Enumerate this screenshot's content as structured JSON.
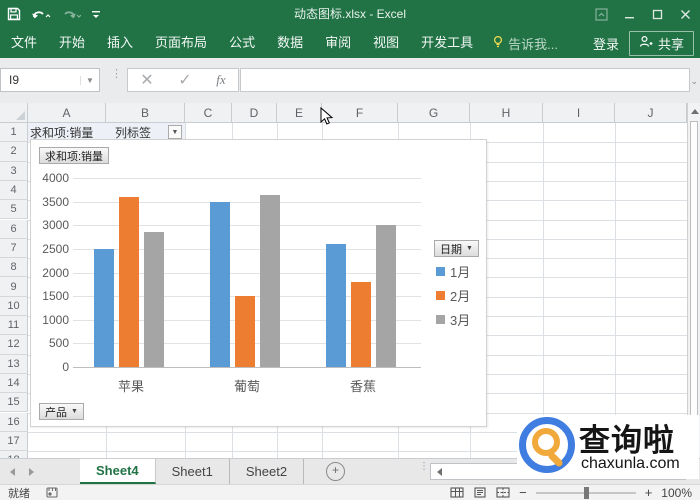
{
  "title_bar": {
    "title": "动态图标.xlsx - Excel"
  },
  "ribbon": {
    "tabs": [
      "文件",
      "开始",
      "插入",
      "页面布局",
      "公式",
      "数据",
      "审阅",
      "视图",
      "开发工具"
    ],
    "tell_me": "告诉我...",
    "sign_in": "登录",
    "share": "共享"
  },
  "formula_bar": {
    "name_box": "I9",
    "cancel_label": "✕",
    "enter_label": "✓",
    "fx_label": "fx",
    "value": ""
  },
  "grid": {
    "columns": [
      "A",
      "B",
      "C",
      "D",
      "E",
      "F",
      "G",
      "H",
      "I",
      "J"
    ],
    "row_count": 18,
    "cells": {
      "A1": "求和项:销量",
      "B1": "列标签"
    }
  },
  "chart_data": {
    "type": "bar",
    "title": "",
    "categories": [
      "苹果",
      "葡萄",
      "香蕉"
    ],
    "series": [
      {
        "name": "1月",
        "color": "#5B9BD5",
        "values": [
          2500,
          3500,
          2600
        ]
      },
      {
        "name": "2月",
        "color": "#ED7D31",
        "values": [
          3600,
          1500,
          1800
        ]
      },
      {
        "name": "3月",
        "color": "#A5A5A5",
        "values": [
          2850,
          3650,
          3000
        ]
      }
    ],
    "ylim": [
      0,
      4000
    ],
    "ytick_step": 500,
    "grid": true,
    "legend_position": "right",
    "legend_title": "日期",
    "value_field_button": "求和项:销量",
    "legend_field_button": "日期",
    "axis_field_button": "产品"
  },
  "sheet_tabs": {
    "tabs": [
      "Sheet4",
      "Sheet1",
      "Sheet2"
    ],
    "active": "Sheet4",
    "add_label": "+"
  },
  "status_bar": {
    "ready": "就绪",
    "zoom_minus": "−",
    "zoom_plus": "+",
    "zoom_level": "100%"
  },
  "watermark": {
    "brand": "查询啦",
    "domain": "chaxunla.com"
  }
}
